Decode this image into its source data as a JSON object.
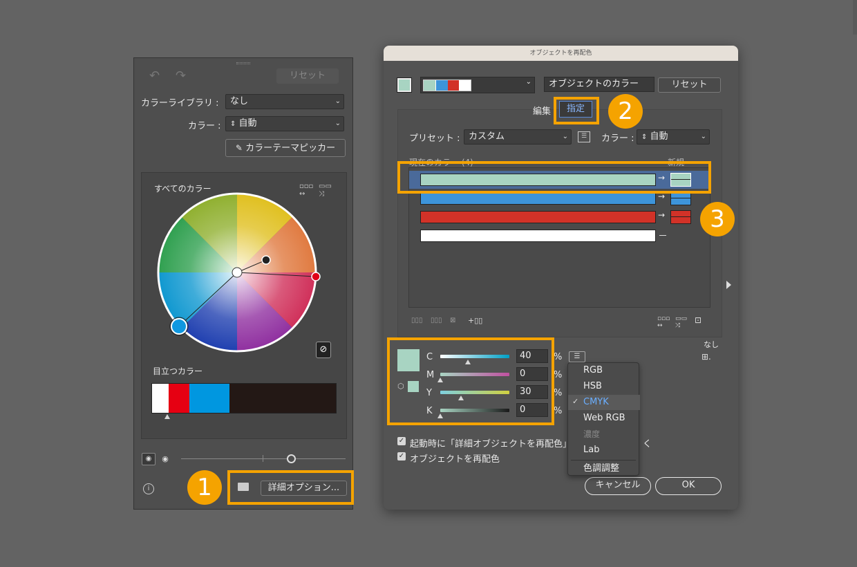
{
  "left_panel": {
    "reset_label": "リセット",
    "color_library_label": "カラーライブラリ :",
    "color_library_value": "なし",
    "color_label": "カラー :",
    "color_value": "自動",
    "theme_picker_label": "カラーテーマピッカー",
    "all_colors_label": "すべてのカラー",
    "prominent_colors_label": "目立つカラー",
    "advanced_options_label": "詳細オプション...",
    "prominent_colors": [
      "#ffffff",
      "#e60012",
      "#0097e0",
      "#231815"
    ]
  },
  "badges": {
    "one": "1",
    "two": "2",
    "three": "3"
  },
  "dialog": {
    "title": "オブジェクトを再配色",
    "object_colors_label": "オブジェクトのカラー",
    "reset_label": "リセット",
    "tab_edit": "編集",
    "tab_assign": "指定",
    "preset_label": "プリセット :",
    "preset_value": "カスタム",
    "color_label": "カラー :",
    "color_value": "自動",
    "current_colors_label": "現在のカラー (4)",
    "new_label": "新規",
    "none_label": "なし",
    "color_rows": [
      {
        "current": "#a8d4c2",
        "new": "#a8d4c2"
      },
      {
        "current": "#3d94da",
        "new": "#3d94da"
      },
      {
        "current": "#d23228",
        "new": "#d23228"
      },
      {
        "current": "#ffffff",
        "new": ""
      }
    ],
    "cmyk": {
      "c_label": "C",
      "c_value": "40",
      "m_label": "M",
      "m_value": "0",
      "y_label": "Y",
      "y_value": "30",
      "k_label": "K",
      "k_value": "0",
      "percent": "%",
      "swatch_color": "#a8d4c2"
    },
    "mode_menu": {
      "items": [
        "RGB",
        "HSB",
        "CMYK",
        "Web RGB",
        "濃度",
        "Lab",
        "色調調整"
      ],
      "checkmark": "✓"
    },
    "checkbox_open_on_start": "起動時に「詳細オブジェクトを再配色」",
    "checkbox_open_on_start_tail": "く",
    "checkbox_recolor": "オブジェクトを再配色",
    "cancel_label": "キャンセル",
    "ok_label": "OK"
  },
  "colors": {
    "accent": "#f5a300",
    "selected_row": "#4a6a9a"
  }
}
